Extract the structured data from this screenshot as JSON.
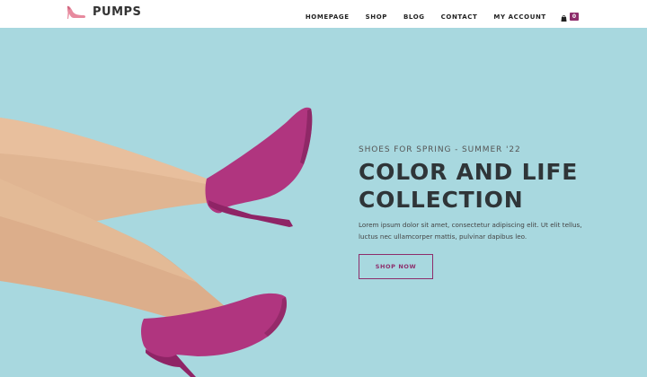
{
  "header": {
    "logo_text": "PUMPS",
    "nav": [
      {
        "label": "HOMEPAGE"
      },
      {
        "label": "SHOP"
      },
      {
        "label": "BLOG"
      },
      {
        "label": "CONTACT"
      },
      {
        "label": "MY ACCOUNT"
      }
    ],
    "cart": {
      "icon": "shopping-bag-icon",
      "count": "0"
    }
  },
  "hero": {
    "subtitle": "SHOES FOR SPRING - SUMMER '22",
    "title_line1": "COLOR AND LIFE",
    "title_line2": "COLLECTION",
    "description_line1": "Lorem ipsum dolor sit amet, consectetur adipiscing elit. Ut elit tellus,",
    "description_line2": "luctus nec ullamcorper mattis, pulvinar dapibus leo.",
    "cta_label": "SHOP NOW",
    "image": "legs-with-magenta-high-heels"
  },
  "colors": {
    "background": "#a8d8df",
    "accent": "#8d2d6b",
    "shoe": "#b0357f",
    "skin": "#e0b592",
    "header_bg": "#ffffff",
    "text_dark": "#2f3538"
  }
}
